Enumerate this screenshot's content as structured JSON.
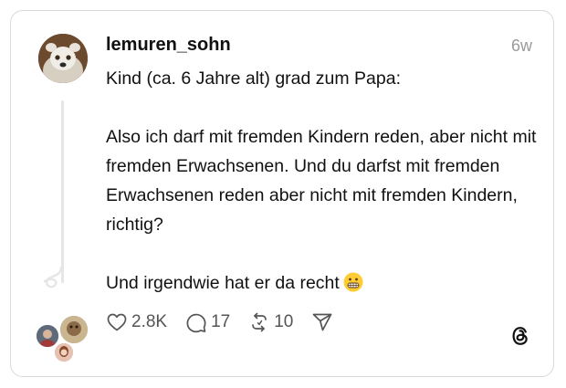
{
  "post": {
    "username": "lemuren_sohn",
    "time": "6w",
    "lines": [
      "Kind (ca. 6 Jahre alt) grad zum Papa:",
      "",
      "Also ich darf mit fremden Kindern reden, aber nicht mit fremden Erwachsenen. Und du darfst mit fremden Erwachsenen reden aber nicht mit fremden Kindern, richtig?",
      "",
      "Und irgendwie hat er da recht"
    ],
    "emoji": "grimacing-face"
  },
  "actions": {
    "likes": "2.8K",
    "replies": "17",
    "reposts": "10"
  },
  "icons": {
    "like": "heart-icon",
    "reply": "speech-bubble-icon",
    "repost": "repost-icon",
    "share": "send-icon",
    "brand": "threads-logo"
  },
  "colors": {
    "text": "#111111",
    "muted": "#9a9a9a",
    "border": "#d9d9d9",
    "thread_line": "#e6e6e6"
  }
}
